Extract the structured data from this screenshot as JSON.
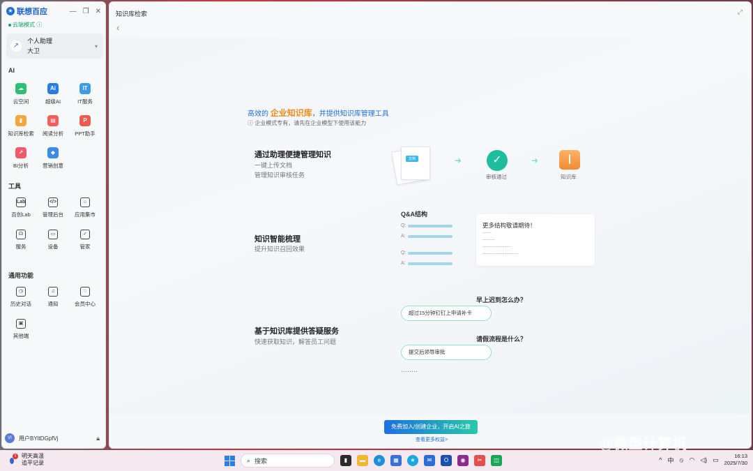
{
  "sidebar": {
    "brand": "联想百应",
    "mode": "云端模式",
    "assistant": {
      "name": "个人助理",
      "user": "大卫"
    },
    "sections": {
      "ai": "AI",
      "tools": "工具",
      "general": "通用功能"
    },
    "ai_items": [
      {
        "label": "云空间",
        "color": "#2dbf73",
        "glyph": "☁"
      },
      {
        "label": "超级AI",
        "color": "#2a7be8",
        "glyph": "Ai"
      },
      {
        "label": "IT服务",
        "color": "#3b9be8",
        "glyph": "IT"
      },
      {
        "label": "知识库检索",
        "color": "#f5a53c",
        "glyph": "▮"
      },
      {
        "label": "阅读分析",
        "color": "#f0605a",
        "glyph": "▤"
      },
      {
        "label": "PPT助手",
        "color": "#f05a4a",
        "glyph": "P"
      },
      {
        "label": "BI分析",
        "color": "#f05a6a",
        "glyph": "↗"
      },
      {
        "label": "营销创意",
        "color": "#3a8be8",
        "glyph": "◆"
      }
    ],
    "tool_items": [
      {
        "label": "百创Lab",
        "glyph": "Lab"
      },
      {
        "label": "管理后台",
        "glyph": "</>"
      },
      {
        "label": "应用集市",
        "glyph": "⌂"
      },
      {
        "label": "服务",
        "glyph": "☊"
      },
      {
        "label": "设备",
        "glyph": "▭"
      },
      {
        "label": "管家",
        "glyph": "✓"
      }
    ],
    "general_items": [
      {
        "label": "历史对话",
        "glyph": "◷"
      },
      {
        "label": "通知",
        "glyph": "♫"
      },
      {
        "label": "会员中心",
        "glyph": "♢"
      },
      {
        "label": "其他端",
        "glyph": "▣"
      }
    ],
    "user": {
      "avatar": "VI",
      "name": "用户BYltDGpfVj"
    }
  },
  "main": {
    "title": "知识库检索",
    "hero_pre": "高效的",
    "hero_highlight": "企业知识库",
    "hero_post": "，并提供知识库管理工具",
    "hero_note": "企业模式专有，请先在企业模型下使用该能力",
    "feature1": {
      "title": "通过助理便捷管理知识",
      "line1": "一键上传文档",
      "line2": "管理知识审核任务"
    },
    "flow": {
      "doc_tag": "文档",
      "step2": "审核通过",
      "step3": "知识库"
    },
    "feature2": {
      "title": "知识智能梳理",
      "line1": "提升知识召回效果"
    },
    "qa": {
      "title": "Q&A结构",
      "q": "Q:",
      "a": "A:"
    },
    "more": {
      "text": "更多结构敬请期待！"
    },
    "feature3": {
      "title": "基于知识库提供答疑服务",
      "line1": "快速获取知识，解答员工问题"
    },
    "chat": [
      {
        "q": "早上迟到怎么办？",
        "a": "超过15分钟钉钉上申请补卡"
      },
      {
        "q": "请假流程是什么？",
        "a": "提交后领导审批"
      }
    ],
    "ellipsis": "········",
    "cta": "免费加入/创建企业，开启AI之旅",
    "cta_link": "查看更多权益>"
  },
  "taskbar": {
    "weather_line1": "明天高温",
    "weather_line2": "追平记录",
    "weather_badge": "5",
    "search_placeholder": "搜索",
    "ime": "中",
    "time": "16:13",
    "date": "2025/7/30"
  },
  "watermark": "@微型计算机"
}
